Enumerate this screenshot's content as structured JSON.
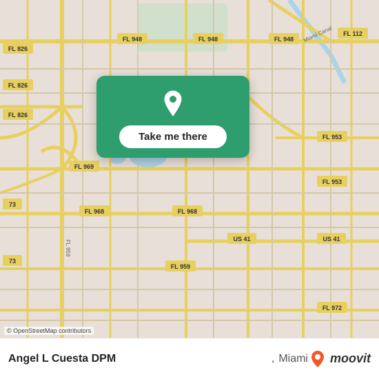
{
  "map": {
    "background_color": "#e8e0d8",
    "osm_credit": "© OpenStreetMap contributors"
  },
  "popup": {
    "button_label": "Take me there",
    "pin_color": "#ffffff"
  },
  "bottom_bar": {
    "location_name": "Angel L Cuesta DPM",
    "location_city": "Miami",
    "separator": ","
  },
  "moovit": {
    "logo_text": "moovit"
  },
  "route_labels": [
    "FL 826",
    "FL 826",
    "FL 826",
    "FL 948",
    "FL 948",
    "FL 948",
    "FL 112",
    "FL 953",
    "FL 953",
    "FL 969",
    "FL 968",
    "FL 959",
    "US 41",
    "US 41",
    "FL 972",
    "73",
    "73"
  ]
}
